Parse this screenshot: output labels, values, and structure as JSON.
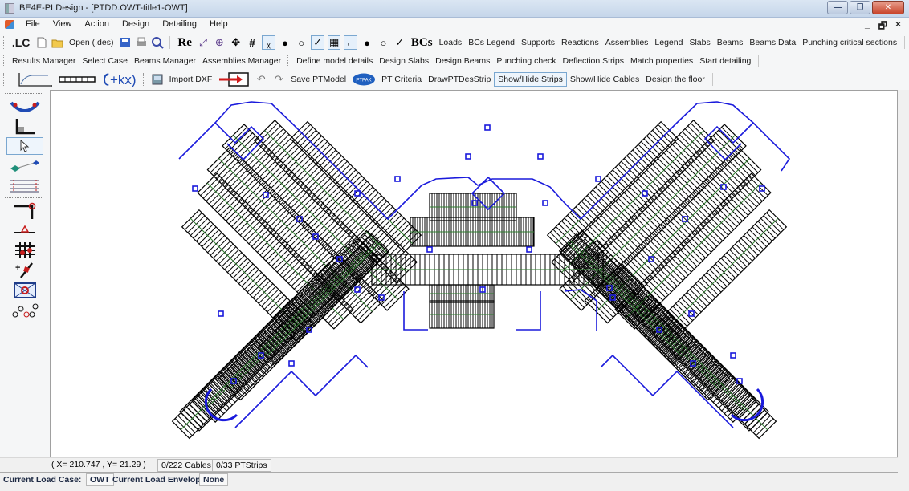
{
  "window": {
    "title": "BE4E-PLDesign - [PTDD.OWT-title1-OWT]",
    "controls": {
      "minimize": "—",
      "restore": "❐",
      "close": "✕"
    },
    "mdi_controls": {
      "minimize": "_",
      "restore": "🗗",
      "close": "×"
    }
  },
  "menu": {
    "items": [
      "File",
      "View",
      "Action",
      "Design",
      "Detailing",
      "Help"
    ]
  },
  "toolbar1": {
    "lc_label": ".LC",
    "new_icon": "new-file-icon",
    "open_label": "Open (.des)",
    "save_icon": "save-icon",
    "print_icon": "print-icon",
    "preview_icon": "print-preview-icon",
    "re_label": "Re",
    "icon_glyphs": {
      "zoom_extents": "⤢",
      "zoom_window": "⊕",
      "pan": "✥",
      "grid": "#",
      "axes": "ᵪ",
      "cable_anchor_filled": "●",
      "cable_anchor_open": "○",
      "beam_check": "✓",
      "frame_box": "▦",
      "frame_corner": "⌐",
      "anchor_filled_plus": "●",
      "anchor_open_plus": "○",
      "wrench": "✓"
    },
    "bcs_label": "BCs",
    "text_buttons": [
      "Loads",
      "BCs Legend",
      "Supports",
      "Reactions",
      "Assemblies",
      "Legend",
      "Slabs",
      "Beams",
      "Beams Data",
      "Punching critical sections"
    ]
  },
  "toolbar2": {
    "group1": [
      "Results Manager",
      "Select Case",
      "Beams Manager",
      "Assemblies Manager"
    ],
    "group2": [
      "Define model details",
      "Design Slabs",
      "Design Beams",
      "Punching check",
      "Deflection Strips",
      "Match properties",
      "Start detailing"
    ]
  },
  "toolbar3": {
    "formula_label": "(ۢ+kx)",
    "import_dxf_label": "Import DXF",
    "undo_glyph": "↶",
    "redo_glyph": "↷",
    "save_ptmodel_label": "Save PTModel",
    "ptpak_label": "PTPAK",
    "text_buttons": [
      "PT Criteria",
      "DrawPTDesStrip",
      "Show/Hide Strips",
      "Show/Hide Cables",
      "Design the floor"
    ],
    "active_button": "Show/Hide Strips"
  },
  "left_tools": [
    {
      "name": "cable-profile-tool"
    },
    {
      "name": "support-l-tool"
    },
    {
      "name": "select-pointer-tool",
      "active": true
    },
    {
      "name": "node-link-tool"
    },
    {
      "name": "strip-grid-tool"
    },
    {
      "name": "column-connect-tool"
    },
    {
      "name": "support-point-tool"
    },
    {
      "name": "column-grid-tool"
    },
    {
      "name": "add-point-line-tool"
    },
    {
      "name": "opening-tool"
    },
    {
      "name": "nodes-tool"
    }
  ],
  "status": {
    "coords": "( X= 210.747 , Y= 21.29 )",
    "cables": "0/222 Cables",
    "ptstrips": "0/33 PTStrips",
    "load_case_label": "Current Load Case:",
    "load_case_value": "OWT",
    "load_envelope_label": "Current Load Envelope:",
    "load_envelope_value": "None"
  },
  "colors": {
    "outline": "#1a1adc",
    "strip": "#000000",
    "cable": "#2e7d2e",
    "active_border": "#7aa7d0",
    "ptpak": "#1f5fbf"
  }
}
